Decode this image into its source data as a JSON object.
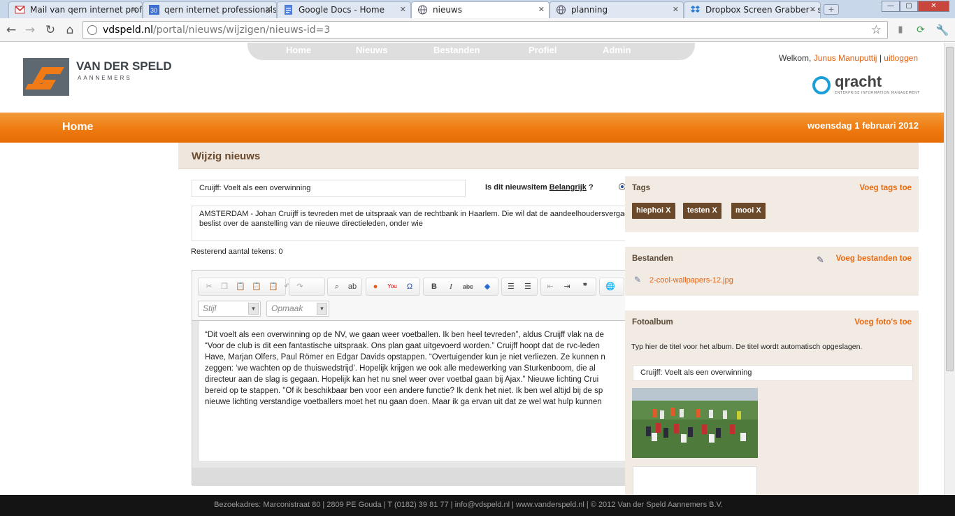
{
  "browser": {
    "tabs": [
      {
        "title": "Mail van qern internet profe",
        "icon": "gmail-icon"
      },
      {
        "title": "qern internet professionals -",
        "icon": "calendar-icon"
      },
      {
        "title": "Google Docs - Home",
        "icon": "docs-icon"
      },
      {
        "title": "nieuws",
        "icon": "globe-icon"
      },
      {
        "title": "planning",
        "icon": "globe-icon"
      },
      {
        "title": "Dropbox Screen Grabber - s",
        "icon": "dropbox-icon"
      }
    ],
    "url_domain": "vdspeld.nl",
    "url_path": "/portal/nieuws/wijzigen/nieuws-id=3"
  },
  "header": {
    "logo_name": "VAN DER SPELD",
    "logo_sub": "AANNEMERS",
    "nav": [
      "Home",
      "Nieuws",
      "Bestanden",
      "Profiel",
      "Admin"
    ],
    "welcome_prefix": "Welkom,",
    "user_name": "Junus Manuputtij",
    "separator": "|",
    "logout": "uitloggen",
    "partner_logo": "qracht",
    "partner_sub": "ENTERPRISE INFORMATION MANAGEMENT"
  },
  "bar": {
    "section": "Home",
    "date": "woensdag 1 februari 2012"
  },
  "page": {
    "title": "Wijzig nieuws",
    "news_title": "Cruijff: Voelt als een overwinning",
    "important_prefix": "Is dit nieuwsitem",
    "important_word": "Belangrijk",
    "important_suffix": "?",
    "intro_line1": "AMSTERDAM - Johan Cruijff is tevreden met de uitspraak van de rechtbank in Haarlem. Die wil dat de aandeelhoudersvergadering",
    "intro_line2": "beslist over de aanstelling van de nieuwe directieleden, onder wie",
    "remaining": "Resterend aantal tekens: 0"
  },
  "editor": {
    "style_combo": "Stijl",
    "format_combo": "Opmaak",
    "body_lines": [
      "“Dit voelt als een overwinning op de NV, we gaan weer voetballen. Ik ben heel tevreden”, aldus Cruijff vlak na de",
      "“Voor de club is dit een fantastische uitspraak. Ons plan gaat uitgevoerd worden.” Cruijff hoopt dat de rvc-leden",
      "Have, Marjan Olfers, Paul Römer en Edgar Davids opstappen. “Overtuigender kun je niet verliezen. Ze kunnen n",
      "zeggen: ‘we wachten op de thuiswedstrijd’. Hopelijk krijgen we ook alle medewerking van Sturkenboom, die al",
      "directeur aan de slag is gegaan. Hopelijk kan het nu snel weer over voetbal gaan bij Ajax.” Nieuwe lichting Crui",
      "bereid op te stappen. \"Of ik beschikbaar ben voor een andere functie? Ik denk het niet. Ik ben wel altijd bij de sp",
      "nieuwe lichting verstandige voetballers moet het nu gaan doen. Maar ik ga ervan uit dat ze wel wat hulp kunnen"
    ]
  },
  "sidebar": {
    "tags_title": "Tags",
    "tags_add": "Voeg tags toe",
    "tags": [
      "hiephoi X",
      "testen X",
      "mooi X"
    ],
    "files_title": "Bestanden",
    "files_add": "Voeg bestanden toe",
    "files": [
      "2-cool-wallpapers-12.jpg"
    ],
    "album_title": "Fotoalbum",
    "album_add": "Voeg foto's toe",
    "album_help": "Typ hier de titel voor het album. De titel wordt automatisch opgeslagen.",
    "album_name": "Cruijff: Voelt als een overwinning"
  },
  "footer": {
    "text": "Bezoekadres: Marconistraat 80 | 2809 PE Gouda | T (0182) 39 81 77 | info@vdspeld.nl | www.vanderspeld.nl | © 2012 Van der Speld Aannemers B.V."
  },
  "colors": {
    "accent_orange": "#ee7a10",
    "brown": "#6a4a2a",
    "link_orange": "#e86a10",
    "qracht_blue": "#1aa0d6"
  }
}
